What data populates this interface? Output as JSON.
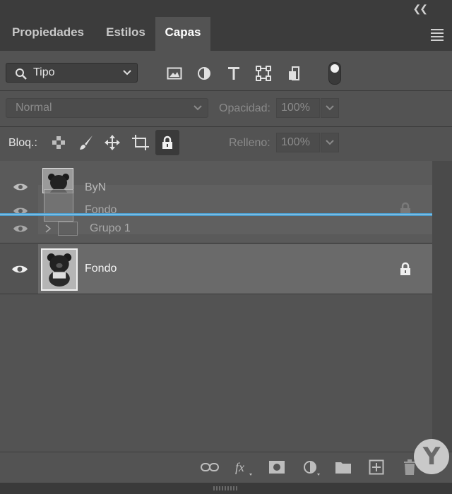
{
  "tabs": [
    {
      "label": "Propiedades"
    },
    {
      "label": "Estilos"
    },
    {
      "label": "Capas"
    }
  ],
  "filter": {
    "kind_label": "Tipo"
  },
  "blend": {
    "mode": "Normal",
    "opacity_label": "Opacidad:",
    "opacity_value": "100%"
  },
  "lock": {
    "label": "Bloq.:",
    "fill_label": "Relleno:",
    "fill_value": "100%"
  },
  "layers": [
    {
      "name": "ByN",
      "visible": true
    },
    {
      "name": "Fondo",
      "visible": true
    },
    {
      "name": "Grupo 1",
      "visible": true
    },
    {
      "name": "Fondo",
      "visible": true,
      "locked": true,
      "selected": true
    }
  ],
  "colors": {
    "panel": "#535353",
    "tab_bar": "#3c3c3c",
    "selected_row": "#6a6a6a",
    "drop_line": "#4aa3d8"
  },
  "icons": {
    "collapse": "double-chevron-left-icon",
    "menu": "hamburger-menu-icon",
    "eye": "eye-icon",
    "lock": "lock-icon"
  },
  "watermark": {
    "glyph": "Y"
  }
}
